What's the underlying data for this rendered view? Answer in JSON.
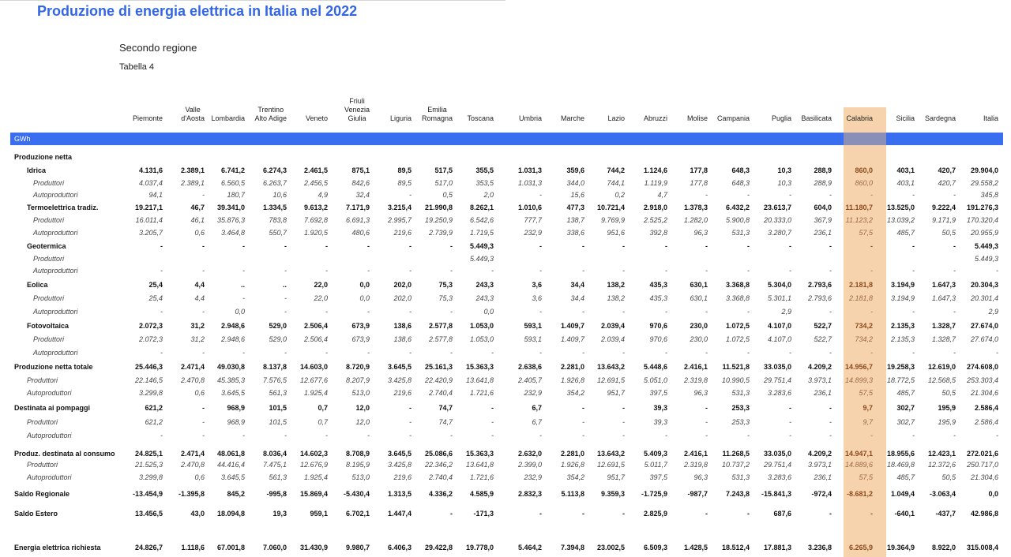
{
  "header": {
    "title": "Produzione di energia elettrica in Italia nel 2022",
    "subtitle": "Secondo regione",
    "table_number": "Tabella 4",
    "unit": "GWh"
  },
  "highlight_color": "#f7d3ad",
  "band_color": "#3a6ef0",
  "title_color": "#3366e6",
  "regions": [
    [
      "Piemonte"
    ],
    [
      "Valle",
      "d'Aosta"
    ],
    [
      "Lombardia"
    ],
    [
      "Trentino",
      "Alto Adige"
    ],
    [
      "Veneto"
    ],
    [
      "Friuli",
      "Venezia",
      "Giulia"
    ],
    [
      "Liguria"
    ],
    [
      "Emilia",
      "Romagna"
    ],
    [
      "Toscana"
    ],
    [
      "Umbria"
    ],
    [
      "Marche"
    ],
    [
      "Lazio"
    ],
    [
      "Abruzzi"
    ],
    [
      "Molise"
    ],
    [
      "Campania"
    ],
    [
      "Puglia"
    ],
    [
      "Basilicata"
    ],
    [
      "Calabria"
    ],
    [
      "Sicilia"
    ],
    [
      "Sardegna"
    ],
    [
      "Italia"
    ]
  ],
  "highlighted_region": "Calabria",
  "rows": [
    {
      "label": "Produzione netta",
      "style": "section",
      "values": []
    },
    {
      "label": "Idrica",
      "style": "bold",
      "indent": 2,
      "values": [
        "4.131,6",
        "2.389,1",
        "6.741,2",
        "6.274,3",
        "2.461,5",
        "875,1",
        "89,5",
        "517,5",
        "355,5",
        "1.031,3",
        "359,6",
        "744,2",
        "1.124,6",
        "177,8",
        "648,3",
        "10,3",
        "288,9",
        "860,0",
        "403,1",
        "420,7",
        "29.904,0"
      ]
    },
    {
      "label": "Produttori",
      "style": "sub",
      "indent": 3,
      "values": [
        "4.037,4",
        "2.389,1",
        "6.560,5",
        "6.263,7",
        "2.456,5",
        "842,6",
        "89,5",
        "517,0",
        "353,5",
        "1.031,3",
        "344,0",
        "744,1",
        "1.119,9",
        "177,8",
        "648,3",
        "10,3",
        "288,9",
        "860,0",
        "403,1",
        "420,7",
        "29.558,2"
      ]
    },
    {
      "label": "Autoproduttori",
      "style": "sub",
      "indent": 3,
      "values": [
        "94,1",
        "-",
        "180,7",
        "10,6",
        "4,9",
        "32,4",
        "-",
        "0,5",
        "2,0",
        "-",
        "15,6",
        "0,2",
        "4,7",
        "-",
        "-",
        "-",
        "-",
        "-",
        "-",
        "-",
        "345,8"
      ]
    },
    {
      "label": "Termoelettrica tradiz.",
      "style": "bold",
      "indent": 2,
      "values": [
        "19.217,1",
        "46,7",
        "39.341,0",
        "1.334,5",
        "9.613,2",
        "7.171,9",
        "3.215,4",
        "21.990,8",
        "8.262,1",
        "1.010,6",
        "477,3",
        "10.721,4",
        "2.918,0",
        "1.378,3",
        "6.432,2",
        "23.613,7",
        "604,0",
        "11.180,7",
        "13.525,0",
        "9.222,4",
        "191.276,3"
      ]
    },
    {
      "label": "Produttori",
      "style": "sub",
      "indent": 3,
      "values": [
        "16.011,4",
        "46,1",
        "35.876,3",
        "783,8",
        "7.692,8",
        "6.691,3",
        "2.995,7",
        "19.250,9",
        "6.542,6",
        "777,7",
        "138,7",
        "9.769,9",
        "2.525,2",
        "1.282,0",
        "5.900,8",
        "20.333,0",
        "367,9",
        "11.123,2",
        "13.039,2",
        "9.171,9",
        "170.320,4"
      ]
    },
    {
      "label": "Autoproduttori",
      "style": "sub",
      "indent": 3,
      "values": [
        "3.205,7",
        "0,6",
        "3.464,8",
        "550,7",
        "1.920,5",
        "480,6",
        "219,6",
        "2.739,9",
        "1.719,5",
        "232,9",
        "338,6",
        "951,6",
        "392,8",
        "96,3",
        "531,3",
        "3.280,7",
        "236,1",
        "57,5",
        "485,7",
        "50,5",
        "20.955,9"
      ]
    },
    {
      "label": "Geotermica",
      "style": "bold",
      "indent": 2,
      "values": [
        "-",
        "-",
        "-",
        "-",
        "-",
        "-",
        "-",
        "-",
        "5.449,3",
        "-",
        "-",
        "-",
        "-",
        "-",
        "-",
        "-",
        "-",
        "-",
        "-",
        "-",
        "5.449,3"
      ]
    },
    {
      "label": "Produttori",
      "style": "sub",
      "indent": 3,
      "values": [
        "",
        "",
        "",
        "",
        "",
        "",
        "",
        "",
        "5.449,3",
        "",
        "",
        "",
        "",
        "",
        "",
        "",
        "",
        "",
        "",
        "",
        "5.449,3"
      ]
    },
    {
      "label": "Autoproduttori",
      "style": "sub",
      "indent": 3,
      "values": [
        "-",
        "-",
        "-",
        "-",
        "-",
        "-",
        "-",
        "-",
        "-",
        "-",
        "-",
        "-",
        "-",
        "-",
        "-",
        "-",
        "-",
        "-",
        "-",
        "-",
        "-"
      ]
    },
    {
      "label": "Eolica",
      "style": "bold",
      "indent": 2,
      "values": [
        "25,4",
        "4,4",
        "..",
        "..",
        "22,0",
        "0,0",
        "202,0",
        "75,3",
        "243,3",
        "3,6",
        "34,4",
        "138,2",
        "435,3",
        "630,1",
        "3.368,8",
        "5.304,0",
        "2.793,6",
        "2.181,8",
        "3.194,9",
        "1.647,3",
        "20.304,3"
      ]
    },
    {
      "label": "Produttori",
      "style": "sub",
      "indent": 3,
      "values": [
        "25,4",
        "4,4",
        "-",
        "-",
        "22,0",
        "0,0",
        "202,0",
        "75,3",
        "243,3",
        "3,6",
        "34,4",
        "138,2",
        "435,3",
        "630,1",
        "3.368,8",
        "5.301,1",
        "2.793,6",
        "2.181,8",
        "3.194,9",
        "1.647,3",
        "20.301,4"
      ]
    },
    {
      "label": "Autoproduttori",
      "style": "sub",
      "indent": 3,
      "values": [
        "-",
        "-",
        "0,0",
        "-",
        "-",
        "-",
        "-",
        "-",
        "0,0",
        "-",
        "-",
        "-",
        "-",
        "-",
        "-",
        "2,9",
        "-",
        "-",
        "-",
        "-",
        "2,9"
      ]
    },
    {
      "label": "Fotovoltaica",
      "style": "bold",
      "indent": 2,
      "values": [
        "2.072,3",
        "31,2",
        "2.948,6",
        "529,0",
        "2.506,4",
        "673,9",
        "138,6",
        "2.577,8",
        "1.053,0",
        "593,1",
        "1.409,7",
        "2.039,4",
        "970,6",
        "230,0",
        "1.072,5",
        "4.107,0",
        "522,7",
        "734,2",
        "2.135,3",
        "1.328,7",
        "27.674,0"
      ]
    },
    {
      "label": "Produttori",
      "style": "sub",
      "indent": 3,
      "values": [
        "2.072,3",
        "31,2",
        "2.948,6",
        "529,0",
        "2.506,4",
        "673,9",
        "138,6",
        "2.577,8",
        "1.053,0",
        "593,1",
        "1.409,7",
        "2.039,4",
        "970,6",
        "230,0",
        "1.072,5",
        "4.107,0",
        "522,7",
        "734,2",
        "2.135,3",
        "1.328,7",
        "27.674,0"
      ]
    },
    {
      "label": "Autoproduttori",
      "style": "sub",
      "indent": 3,
      "values": [
        "-",
        "-",
        "-",
        "-",
        "-",
        "-",
        "-",
        "-",
        "-",
        "-",
        "-",
        "-",
        "-",
        "-",
        "-",
        "-",
        "-",
        "-",
        "-",
        "-",
        "-"
      ]
    },
    {
      "label": "Produzione netta totale",
      "style": "bold",
      "indent": 1,
      "values": [
        "25.446,3",
        "2.471,4",
        "49.030,8",
        "8.137,8",
        "14.603,0",
        "8.720,9",
        "3.645,5",
        "25.161,3",
        "15.363,3",
        "2.638,6",
        "2.281,0",
        "13.643,2",
        "5.448,6",
        "2.416,1",
        "11.521,8",
        "33.035,0",
        "4.209,2",
        "14.956,7",
        "19.258,3",
        "12.619,0",
        "274.608,0"
      ]
    },
    {
      "label": "Produttori",
      "style": "sub",
      "indent": 2,
      "values": [
        "22.146,5",
        "2.470,8",
        "45.385,3",
        "7.576,5",
        "12.677,6",
        "8.207,9",
        "3.425,8",
        "22.420,9",
        "13.641,8",
        "2.405,7",
        "1.926,8",
        "12.691,5",
        "5.051,0",
        "2.319,8",
        "10.990,5",
        "29.751,4",
        "3.973,1",
        "14.899,3",
        "18.772,5",
        "12.568,5",
        "253.303,4"
      ]
    },
    {
      "label": "Autoproduttori",
      "style": "sub",
      "indent": 2,
      "values": [
        "3.299,8",
        "0,6",
        "3.645,5",
        "561,3",
        "1.925,4",
        "513,0",
        "219,6",
        "2.740,4",
        "1.721,6",
        "232,9",
        "354,2",
        "951,7",
        "397,5",
        "96,3",
        "531,3",
        "3.283,6",
        "236,1",
        "57,5",
        "485,7",
        "50,5",
        "21.304,6"
      ]
    },
    {
      "label": "Destinata ai pompaggi",
      "style": "bold",
      "indent": 1,
      "values": [
        "621,2",
        "-",
        "968,9",
        "101,5",
        "0,7",
        "12,0",
        "-",
        "74,7",
        "-",
        "6,7",
        "-",
        "-",
        "39,3",
        "-",
        "253,3",
        "-",
        "-",
        "9,7",
        "302,7",
        "195,9",
        "2.586,4"
      ]
    },
    {
      "label": "Produttori",
      "style": "sub",
      "indent": 2,
      "values": [
        "621,2",
        "-",
        "968,9",
        "101,5",
        "0,7",
        "12,0",
        "-",
        "74,7",
        "-",
        "6,7",
        "-",
        "-",
        "39,3",
        "-",
        "253,3",
        "-",
        "-",
        "9,7",
        "302,7",
        "195,9",
        "2.586,4"
      ]
    },
    {
      "label": "Autoproduttori",
      "style": "sub",
      "indent": 2,
      "values": [
        "-",
        "-",
        "-",
        "-",
        "-",
        "-",
        "-",
        "-",
        "-",
        "-",
        "-",
        "-",
        "-",
        "-",
        "-",
        "-",
        "-",
        "-",
        "-",
        "-",
        "-"
      ]
    },
    {
      "label": "Produz. destinata al consumo",
      "style": "bold",
      "indent": 1,
      "values": [
        "24.825,1",
        "2.471,4",
        "48.061,8",
        "8.036,4",
        "14.602,3",
        "8.708,9",
        "3.645,5",
        "25.086,6",
        "15.363,3",
        "2.632,0",
        "2.281,0",
        "13.643,2",
        "5.409,3",
        "2.416,1",
        "11.268,5",
        "33.035,0",
        "4.209,2",
        "14.947,1",
        "18.955,6",
        "12.423,1",
        "272.021,6"
      ]
    },
    {
      "label": "Produttori",
      "style": "sub",
      "indent": 2,
      "values": [
        "21.525,3",
        "2.470,8",
        "44.416,4",
        "7.475,1",
        "12.676,9",
        "8.195,9",
        "3.425,8",
        "22.346,2",
        "13.641,8",
        "2.399,0",
        "1.926,8",
        "12.691,5",
        "5.011,7",
        "2.319,8",
        "10.737,2",
        "29.751,4",
        "3.973,1",
        "14.889,6",
        "18.469,8",
        "12.372,6",
        "250.717,0"
      ]
    },
    {
      "label": "Autoproduttori",
      "style": "sub",
      "indent": 2,
      "values": [
        "3.299,8",
        "0,6",
        "3.645,5",
        "561,3",
        "1.925,4",
        "513,0",
        "219,6",
        "2.740,4",
        "1.721,6",
        "232,9",
        "354,2",
        "951,7",
        "397,5",
        "96,3",
        "531,3",
        "3.283,6",
        "236,1",
        "57,5",
        "485,7",
        "50,5",
        "21.304,6"
      ]
    },
    {
      "label": "Saldo Regionale",
      "style": "bold",
      "indent": 1,
      "values": [
        "-13.454,9",
        "-1.395,8",
        "845,2",
        "-995,8",
        "15.869,4",
        "-5.430,4",
        "1.313,5",
        "4.336,2",
        "4.585,9",
        "2.832,3",
        "5.113,8",
        "9.359,3",
        "-1.725,9",
        "-987,7",
        "7.243,8",
        "-15.841,3",
        "-972,4",
        "-8.681,2",
        "1.049,4",
        "-3.063,4",
        "0,0"
      ]
    },
    {
      "label": "Saldo Estero",
      "style": "bold",
      "indent": 1,
      "values": [
        "13.456,5",
        "43,0",
        "18.094,8",
        "19,3",
        "959,1",
        "6.702,1",
        "1.447,4",
        "-",
        "-171,3",
        "-",
        "-",
        "-",
        "2.825,9",
        "-",
        "-",
        "687,6",
        "-",
        "-",
        "-640,1",
        "-437,7",
        "42.986,8"
      ]
    },
    {
      "label": "Energia elettrica richiesta",
      "style": "bold",
      "indent": 1,
      "values": [
        "24.826,7",
        "1.118,6",
        "67.001,8",
        "7.060,0",
        "31.430,9",
        "9.980,7",
        "6.406,3",
        "29.422,8",
        "19.778,0",
        "5.464,2",
        "7.394,8",
        "23.002,5",
        "6.509,3",
        "1.428,5",
        "18.512,4",
        "17.881,3",
        "3.236,8",
        "6.265,9",
        "19.364,9",
        "8.922,0",
        "315.008,4"
      ]
    }
  ]
}
